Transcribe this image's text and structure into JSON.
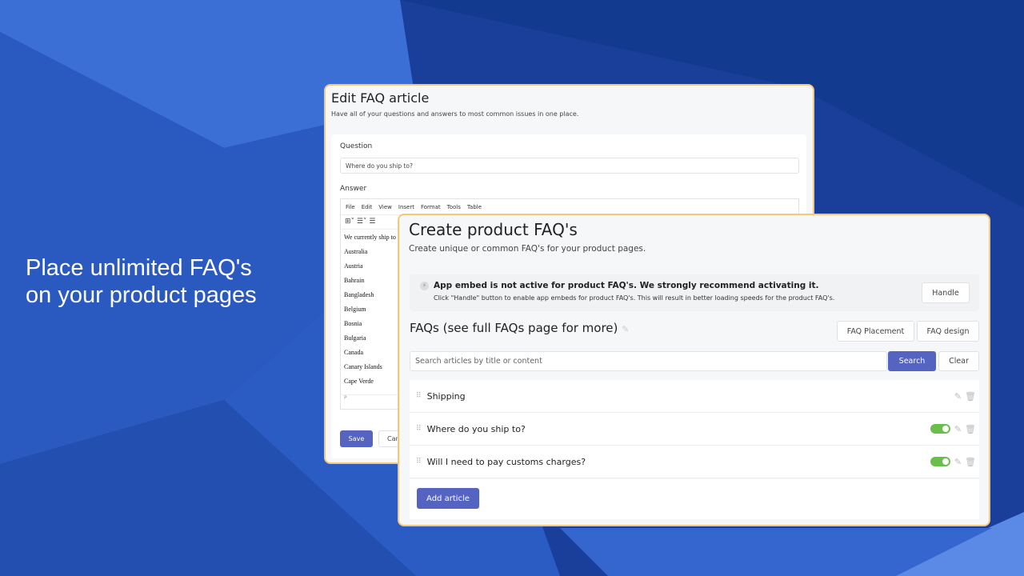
{
  "tagline": {
    "line1": "Place unlimited FAQ's",
    "line2": "on your product pages"
  },
  "edit": {
    "title": "Edit FAQ article",
    "subtitle": "Have all of your questions and answers to most common issues in one place.",
    "question_label": "Question",
    "question_value": "Where do you ship to?",
    "answer_label": "Answer",
    "menu": [
      "File",
      "Edit",
      "View",
      "Insert",
      "Format",
      "Tools",
      "Table"
    ],
    "answer_lines": [
      "We currently ship to",
      "Australia",
      "Austria",
      "Bahrain",
      "Bangladesh",
      "Belgium",
      "Bosnia",
      "Bulgaria",
      "Canada",
      "Canary Islands",
      "Cape Verde"
    ],
    "status_path": "P",
    "save": "Save",
    "cancel": "Cancel"
  },
  "create": {
    "title": "Create product FAQ's",
    "subtitle": "Create unique or common FAQ's for your product pages.",
    "notice_title": "App embed is not active for product FAQ's. We strongly recommend activating it.",
    "notice_text": "Click \"Handle\" button to enable app embeds for product FAQ's. This will result in better loading speeds for the product FAQ's.",
    "handle": "Handle",
    "faqs_heading": "FAQs (see full FAQs page for more)",
    "placement": "FAQ Placement",
    "design": "FAQ design",
    "search_placeholder": "Search articles by title or content",
    "search": "Search",
    "clear": "Clear",
    "rows": [
      {
        "title": "Shipping",
        "toggle": false
      },
      {
        "title": "Where do you ship to?",
        "toggle": true
      },
      {
        "title": "Will I need to pay customs charges?",
        "toggle": true
      }
    ],
    "add": "Add article"
  },
  "colors": {
    "accent": "#5563c1",
    "toggle_on": "#6abf4b",
    "border": "#f3c877"
  }
}
